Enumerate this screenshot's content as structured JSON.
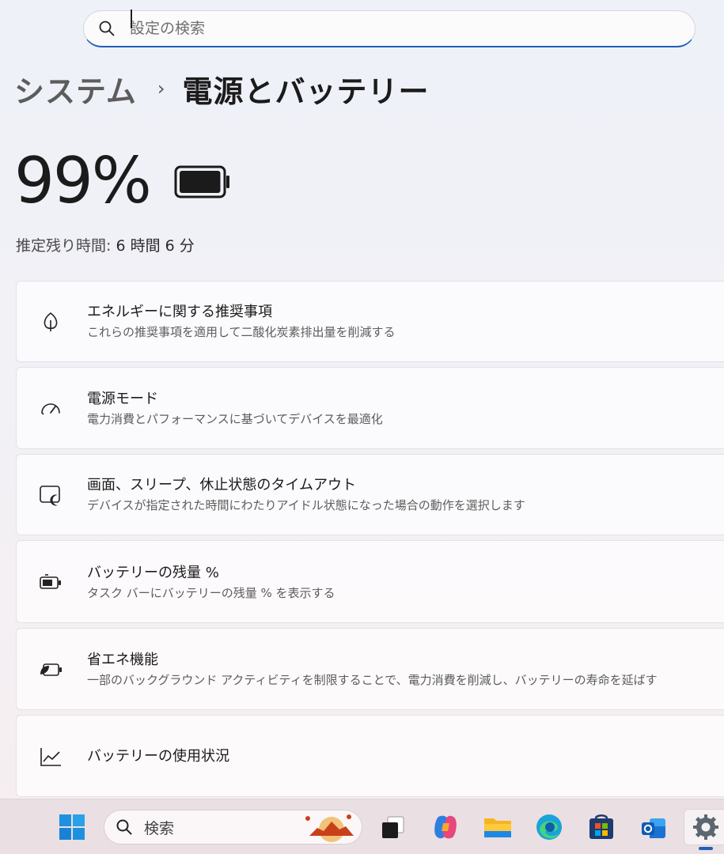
{
  "search": {
    "placeholder": "設定の検索",
    "icon": "search-icon"
  },
  "breadcrumb": {
    "parent": "システム",
    "separator": "›",
    "current": "電源とバッテリー"
  },
  "battery": {
    "percent_text": "99%",
    "percent_value": 99,
    "remaining_label": "推定残り時間:",
    "remaining_value": "6 時間 6 分"
  },
  "cards": [
    {
      "icon": "leaf-icon",
      "title": "エネルギーに関する推奨事項",
      "description": "これらの推奨事項を適用して二酸化炭素排出量を削減する"
    },
    {
      "icon": "speedometer-icon",
      "title": "電源モード",
      "description": "電力消費とパフォーマンスに基づいてデバイスを最適化"
    },
    {
      "icon": "screen-sleep-icon",
      "title": "画面、スリープ、休止状態のタイムアウト",
      "description": "デバイスが指定された時間にわたりアイドル状態になった場合の動作を選択します"
    },
    {
      "icon": "battery-saver-icon",
      "title": "バッテリーの残量 %",
      "description": "タスク バーにバッテリーの残量 % を表示する"
    },
    {
      "icon": "energy-saver-icon",
      "title": "省エネ機能",
      "description": "一部のバックグラウンド アクティビティを制限することで、電力消費を削減し、バッテリーの寿命を延ばす"
    },
    {
      "icon": "chart-line-icon",
      "title": "バッテリーの使用状況",
      "description": ""
    }
  ],
  "taskbar": {
    "search_label": "検索",
    "apps": [
      "windows-start-icon",
      "task-view-icon",
      "copilot-icon",
      "file-explorer-icon",
      "edge-icon",
      "microsoft-store-icon",
      "outlook-icon",
      "settings-icon"
    ],
    "accent_color": "#1f5fb5"
  }
}
